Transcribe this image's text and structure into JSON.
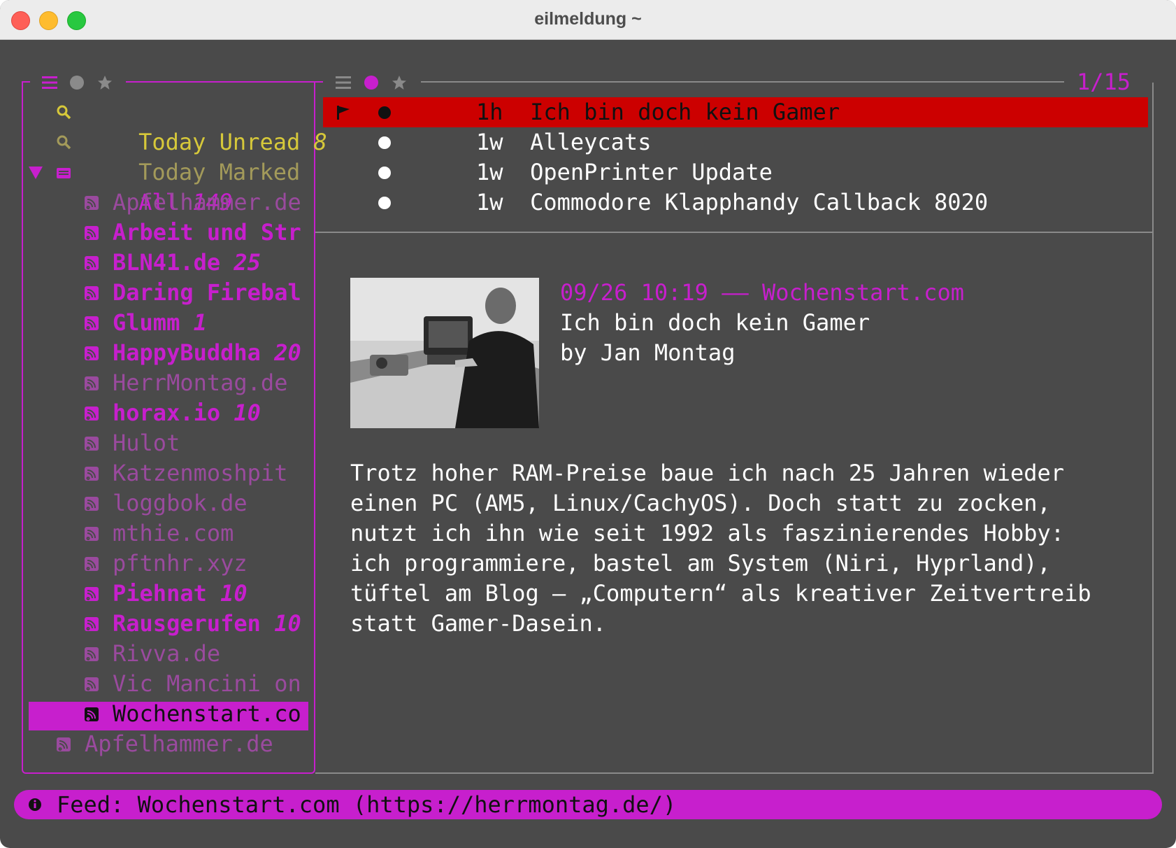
{
  "window": {
    "title": "eilmeldung ~"
  },
  "sidebar": {
    "icons": [
      "menu-icon",
      "dot-icon",
      "star-icon"
    ],
    "items": [
      {
        "label": "Today Unread",
        "count": "8"
      },
      {
        "label": "Today Marked",
        "count": ""
      },
      {
        "label": "All",
        "count": "149"
      }
    ],
    "feeds": [
      {
        "label": "Apfelhammer.de",
        "count": ""
      },
      {
        "label": "Arbeit und Str",
        "count": ""
      },
      {
        "label": "BLN41.de",
        "count": "25"
      },
      {
        "label": "Daring Firebal",
        "count": ""
      },
      {
        "label": "Glumm",
        "count": "1"
      },
      {
        "label": "HappyBuddha",
        "count": "20"
      },
      {
        "label": "HerrMontag.de",
        "count": ""
      },
      {
        "label": "horax.io",
        "count": "10"
      },
      {
        "label": "Hulot",
        "count": ""
      },
      {
        "label": "Katzenmoshpit",
        "count": ""
      },
      {
        "label": "loggbok.de",
        "count": ""
      },
      {
        "label": "mthie.com",
        "count": ""
      },
      {
        "label": "pftnhr.xyz",
        "count": ""
      },
      {
        "label": "Piehnat",
        "count": "10"
      },
      {
        "label": "Rausgerufen",
        "count": "10"
      },
      {
        "label": "Rivva.de",
        "count": ""
      },
      {
        "label": "Vic Mancini on",
        "count": ""
      },
      {
        "label": "Wochenstart.co",
        "count": ""
      }
    ],
    "extra_feed": {
      "label": "Apfelhammer.de"
    }
  },
  "articles": {
    "counter": "1/15",
    "rows": [
      {
        "age": "1h",
        "title": "Ich bin doch kein Gamer"
      },
      {
        "age": "1w",
        "title": "Alleycats"
      },
      {
        "age": "1w",
        "title": "OpenPrinter Update"
      },
      {
        "age": "1w",
        "title": "Commodore Klapphandy Callback 8020"
      }
    ]
  },
  "reader": {
    "meta": "09/26 10:19 —— Wochenstart.com",
    "title": "Ich bin doch kein Gamer",
    "author": "by Jan Montag",
    "body": [
      "Trotz hoher RAM-Preise baue ich nach 25 Jahren wieder",
      "einen PC (AM5, Linux/CachyOS). Doch statt zu zocken,",
      "nutzt ich ihn wie seit 1992 als faszinierendes Hobby:",
      "ich programmiere, bastel am System (Niri, Hyprland),",
      "tüftel am Blog – „Computern“ als kreativer Zeitvertreib",
      "statt Gamer-Dasein."
    ]
  },
  "status": {
    "text": "Feed: Wochenstart.com (https://herrmontag.de/)"
  },
  "colors": {
    "accent": "#c71fcd",
    "selected_row": "#cc0000",
    "unread_yellow": "#d6c83a",
    "background": "#4a4a4a"
  }
}
